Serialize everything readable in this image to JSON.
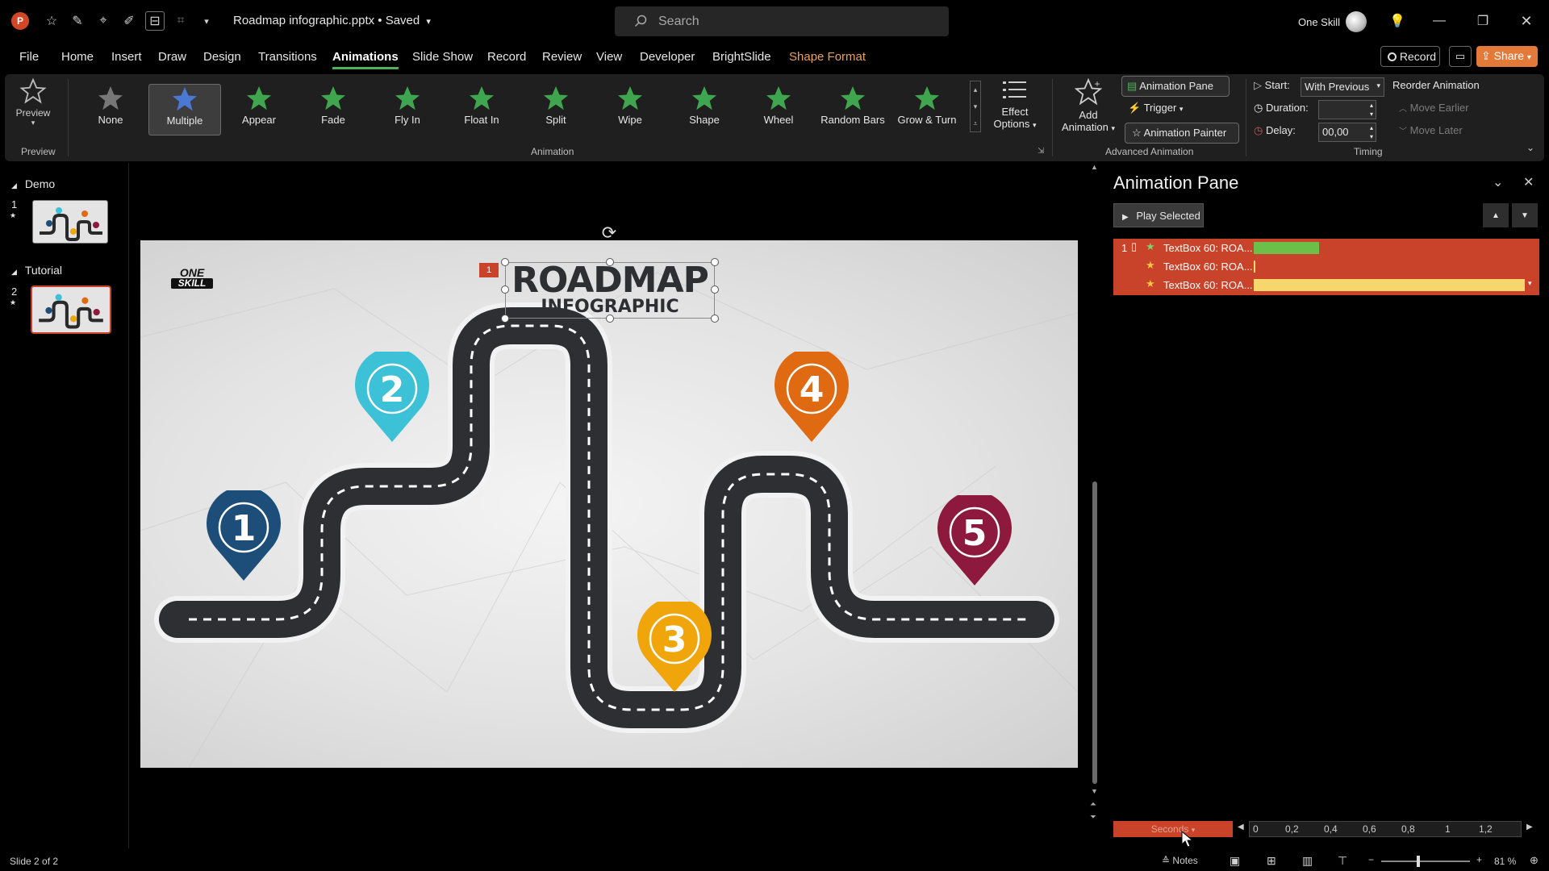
{
  "titlebar": {
    "doc_title": "Roadmap infographic.pptx • Saved",
    "search_placeholder": "Search",
    "user_name": "One Skill"
  },
  "menu": {
    "items": [
      "File",
      "Home",
      "Insert",
      "Draw",
      "Design",
      "Transitions",
      "Animations",
      "Slide Show",
      "Record",
      "Review",
      "View",
      "Developer",
      "BrightSlide",
      "Shape Format"
    ],
    "active": "Animations",
    "record_label": "Record",
    "share_label": "Share"
  },
  "ribbon": {
    "preview_label": "Preview",
    "preview_group": "Preview",
    "animation_group": "Animation",
    "animations": [
      "None",
      "Multiple",
      "Appear",
      "Fade",
      "Fly In",
      "Float In",
      "Split",
      "Wipe",
      "Shape",
      "Wheel",
      "Random Bars",
      "Grow & Turn"
    ],
    "selected_animation": "Multiple",
    "effect_options_1": "Effect",
    "effect_options_2": "Options",
    "add_animation_1": "Add",
    "add_animation_2": "Animation",
    "animation_pane": "Animation Pane",
    "trigger": "Trigger",
    "animation_painter": "Animation Painter",
    "advanced_group": "Advanced Animation",
    "start_label": "Start:",
    "start_value": "With Previous",
    "duration_label": "Duration:",
    "duration_value": "",
    "delay_label": "Delay:",
    "delay_value": "00,00",
    "timing_group": "Timing",
    "reorder_label": "Reorder Animation",
    "move_earlier": "Move Earlier",
    "move_later": "Move Later"
  },
  "thumbnails": {
    "sections": [
      {
        "name": "Demo",
        "slide_number": "1"
      },
      {
        "name": "Tutorial",
        "slide_number": "2"
      }
    ]
  },
  "slide": {
    "logo_top": "ONE",
    "logo_bottom": "SKILL",
    "title_line1": "ROADMAP",
    "title_line2": "INFOGRAPHIC",
    "anim_tag": "1",
    "markers": [
      {
        "number": "1",
        "color": "#1d4e7a"
      },
      {
        "number": "2",
        "color": "#3cc1d6"
      },
      {
        "number": "3",
        "color": "#f0a50a"
      },
      {
        "number": "4",
        "color": "#e06a12"
      },
      {
        "number": "5",
        "color": "#8d1a3e"
      }
    ]
  },
  "animation_pane": {
    "title": "Animation Pane",
    "play_selected": "Play Selected",
    "rows": [
      {
        "index": "1",
        "label": "TextBox 60: ROA...",
        "bar_color": "#6cc04a",
        "bar_start": 0,
        "bar_end": 0.23
      },
      {
        "index": "",
        "label": "TextBox 60: ROA...",
        "bar_color": "#f5d76e",
        "bar_start": 0,
        "bar_end": 0.005
      },
      {
        "index": "",
        "label": "TextBox 60: ROA...",
        "bar_color": "#f5d76e",
        "bar_start": 0,
        "bar_end": 0.96
      }
    ],
    "seconds_label": "Seconds",
    "timeline_ticks": [
      "0",
      "0,2",
      "0,4",
      "0,6",
      "0,8",
      "1",
      "1,2"
    ]
  },
  "status": {
    "slide_info": "Slide 2 of 2",
    "notes_label": "Notes",
    "zoom": "81 %"
  },
  "colors": {
    "accent_red": "#c8432a",
    "accent_green": "#4fb25a",
    "share_orange": "#e37a3a"
  }
}
